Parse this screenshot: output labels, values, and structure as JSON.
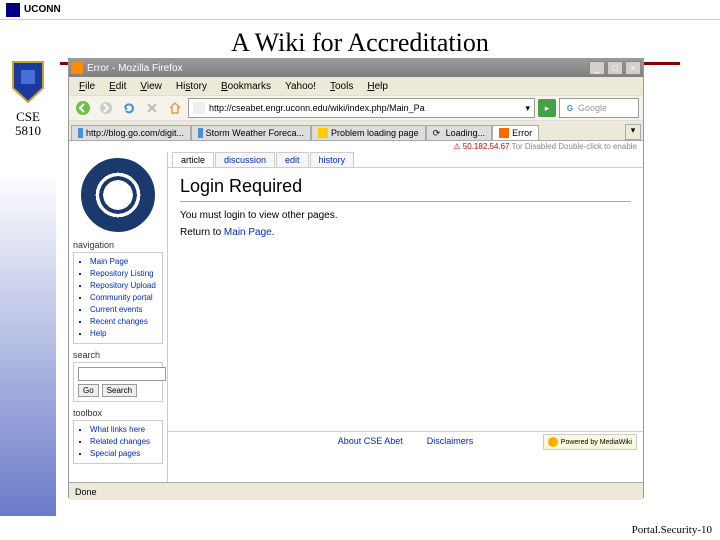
{
  "header": {
    "uconn": "UCONN"
  },
  "slide": {
    "title": "A Wiki for Accreditation"
  },
  "course": {
    "code_line1": "CSE",
    "code_line2": "5810"
  },
  "browser": {
    "title_prefix": "Error",
    "title_app": "Mozilla Firefox",
    "menu": {
      "file": "File",
      "edit": "Edit",
      "view": "View",
      "history": "History",
      "bookmarks": "Bookmarks",
      "yahoo": "Yahoo!",
      "tools": "Tools",
      "help": "Help"
    },
    "url": "http://cseabet.engr.uconn.edu/wiki/index.php/Main_Pa",
    "search_placeholder": "Google",
    "tabs": [
      {
        "label": "http://blog.go.com/digit..."
      },
      {
        "label": "Storm Weather Foreca..."
      },
      {
        "label": "Problem loading page"
      },
      {
        "label": "Loading..."
      },
      {
        "label": "Error"
      }
    ],
    "ip_text": "50.182.54.67",
    "ip_suffix": "Tor Disabled  Double-click to enable",
    "status": "Done"
  },
  "wiki": {
    "tabs": {
      "article": "article",
      "discussion": "discussion",
      "edit": "edit",
      "history": "history"
    },
    "heading": "Login Required",
    "body_text": "You must login to view other pages.",
    "return_prefix": "Return to ",
    "return_link": "Main Page",
    "nav_head": "navigation",
    "nav_items": [
      "Main Page",
      "Repository Listing",
      "Repository Upload",
      "Community portal",
      "Current events",
      "Recent changes",
      "Help"
    ],
    "search_head": "search",
    "search_go": "Go",
    "search_btn": "Search",
    "toolbox_head": "toolbox",
    "toolbox_items": [
      "What links here",
      "Related changes",
      "Special pages"
    ],
    "footer_about": "About CSE Abet",
    "footer_disc": "Disclaimers",
    "mw_badge": "Powered by MediaWiki"
  },
  "footer": {
    "label": "Portal.Security-10"
  }
}
